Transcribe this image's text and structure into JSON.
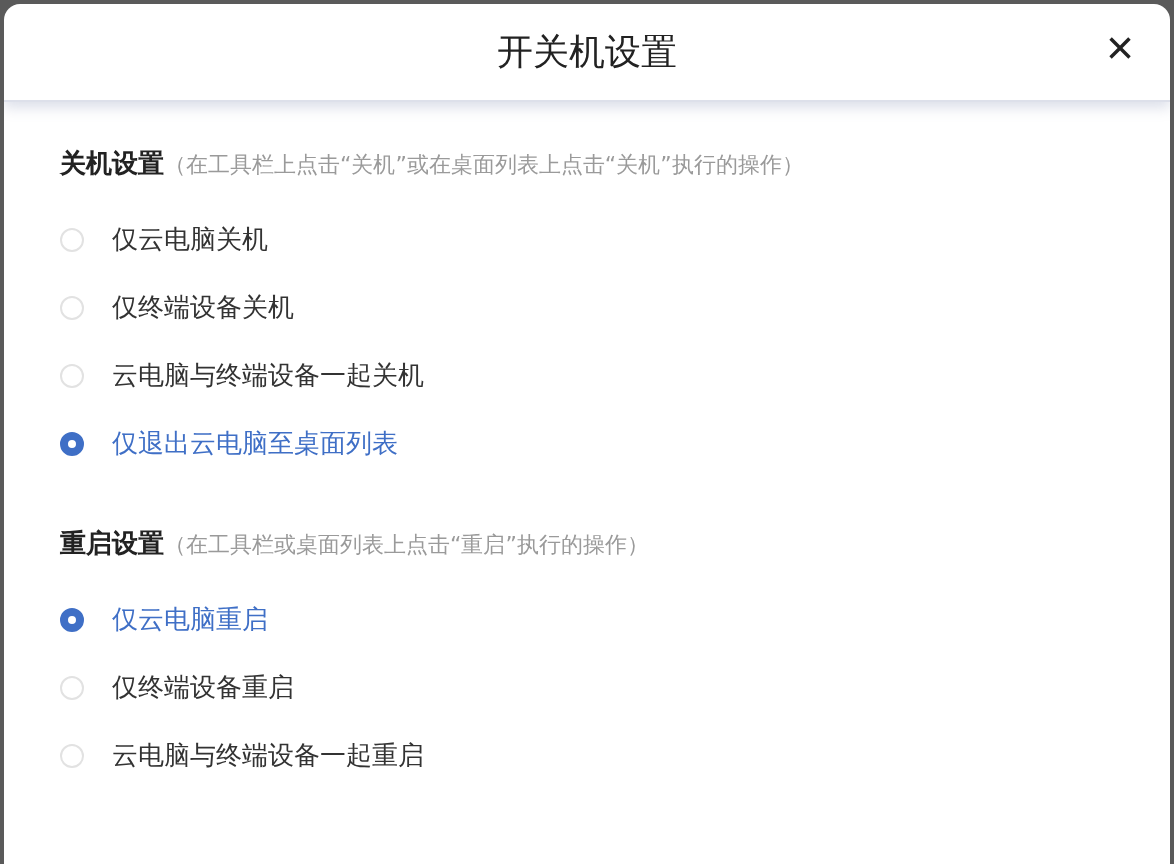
{
  "dialog": {
    "title": "开关机设置",
    "close": "×"
  },
  "sections": [
    {
      "label": "关机设置",
      "hint": "（在工具栏上点击“关机”或在桌面列表上点击“关机”执行的操作）",
      "options": [
        {
          "label": "仅云电脑关机",
          "selected": false
        },
        {
          "label": "仅终端设备关机",
          "selected": false
        },
        {
          "label": "云电脑与终端设备一起关机",
          "selected": false
        },
        {
          "label": "仅退出云电脑至桌面列表",
          "selected": true
        }
      ]
    },
    {
      "label": "重启设置",
      "hint": "（在工具栏或桌面列表上点击“重启”执行的操作）",
      "options": [
        {
          "label": "仅云电脑重启",
          "selected": true
        },
        {
          "label": "仅终端设备重启",
          "selected": false
        },
        {
          "label": "云电脑与终端设备一起重启",
          "selected": false
        }
      ]
    }
  ]
}
